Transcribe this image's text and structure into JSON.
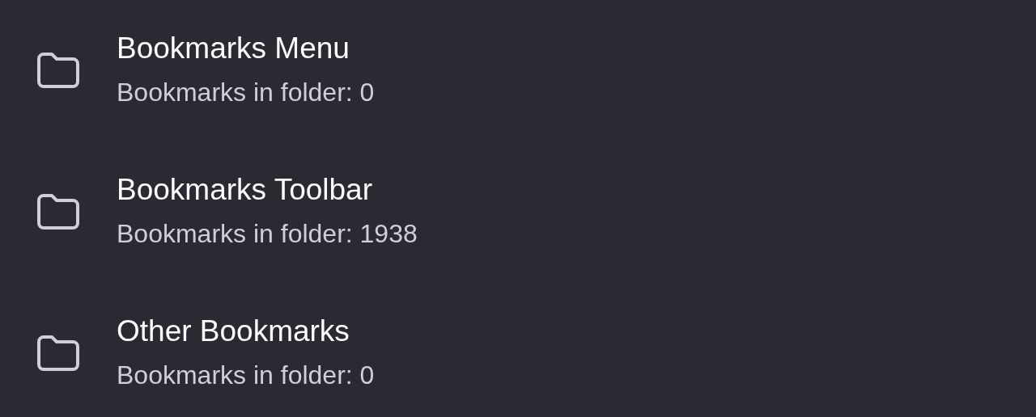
{
  "folders": [
    {
      "title": "Bookmarks Menu",
      "subtitle": "Bookmarks in folder: 0"
    },
    {
      "title": "Bookmarks Toolbar",
      "subtitle": "Bookmarks in folder: 1938"
    },
    {
      "title": "Other Bookmarks",
      "subtitle": "Bookmarks in folder: 0"
    }
  ]
}
